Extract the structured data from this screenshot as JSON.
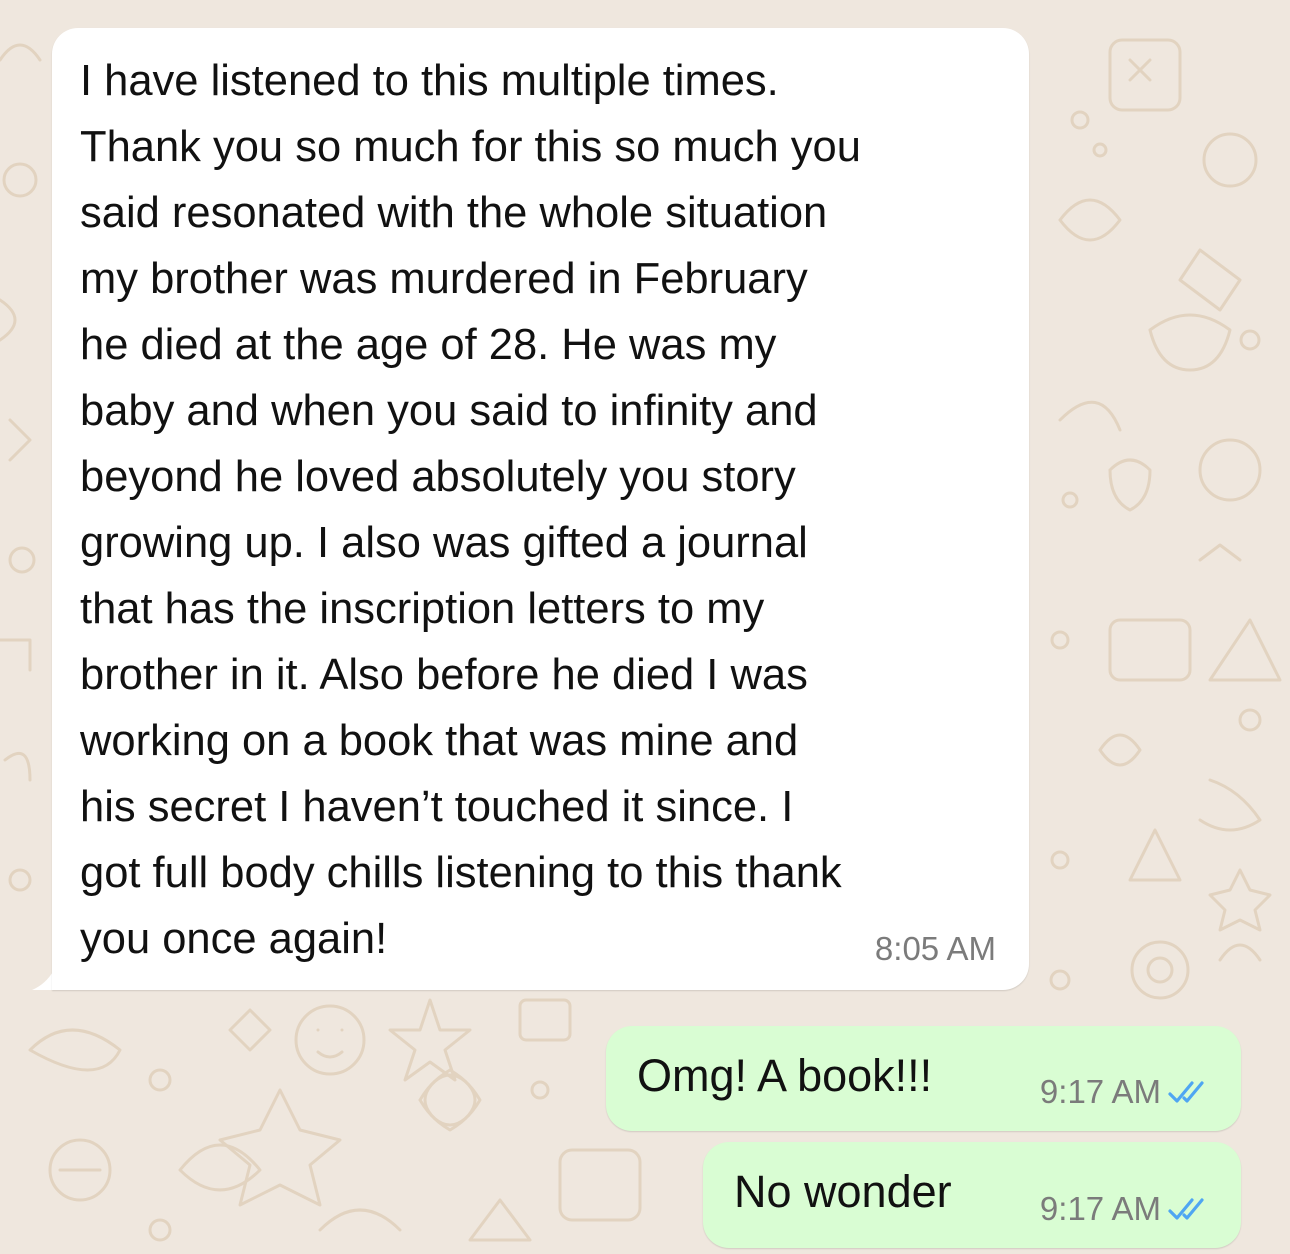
{
  "chat": {
    "incoming": {
      "text": "I have listened to this multiple times.\nThank you so much for this so much you\nsaid resonated with the whole situation\nmy brother was murdered in February\nhe died at the age of 28. He was my\nbaby and when you said to infinity and\nbeyond he loved absolutely you story\ngrowing up. I also was gifted a journal\nthat has the inscription letters to my\nbrother in it. Also before he died I was\nworking on a book that was mine and\nhis secret I haven’t touched it since. I\ngot full body chills listening to this thank\nyou once again!",
      "time": "8:05 AM"
    },
    "outgoing": [
      {
        "text": "Omg! A book!!!",
        "time": "9:17 AM",
        "status_icon": "double-check-read-icon"
      },
      {
        "text": "No wonder",
        "time": "9:17 AM",
        "status_icon": "double-check-read-icon"
      }
    ]
  },
  "colors": {
    "background": "#efe7de",
    "doodle": "#e2d3c0",
    "incoming_bubble": "#ffffff",
    "outgoing_bubble": "#d9fdd3",
    "read_check": "#4fa6f2",
    "timestamp": "#7b7b7b"
  }
}
